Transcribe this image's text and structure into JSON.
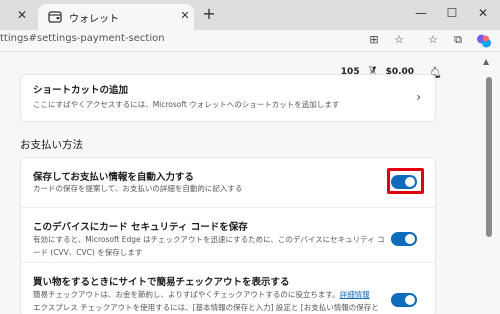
{
  "browser": {
    "tab_title": "ウォレット",
    "new_tab_glyph": "+",
    "prev_tab_close": "✕",
    "tab_close": "✕",
    "window_controls": {
      "minimize": "—",
      "maximize": "☐",
      "close": "✕"
    },
    "url": "ttings#settings-payment-section"
  },
  "wallet_bar": {
    "rewards_count": "105",
    "balance": "$0.00"
  },
  "shortcut_card": {
    "title": "ショートカットの追加",
    "description": "ここにすばやくアクセスするには、Microsoft ウォレットへのショートカットを追加します"
  },
  "payment_section": {
    "heading": "お支払い方法",
    "settings": [
      {
        "title": "保存してお支払い情報を自動入力する",
        "description": "カードの保存を提案して、お支払いの詳細を自動的に記入する",
        "enabled": true
      },
      {
        "title": "このデバイスにカード セキュリティ コードを保存",
        "description_line1": "有効にすると、Microsoft Edge はチェックアウトを迅速にするために、このデバイスにセキュリティ コ",
        "description_line2": "ード (CVV、CVC) を保存します",
        "enabled": true
      },
      {
        "title": "買い物をするときにサイトで簡易チェックアウトを表示する",
        "description_line1": "簡易チェックアウトは、お金を節約し、よりすばやくチェックアウトするのに役立ちます。",
        "link": "詳細情報",
        "description_line2": "エクスプレス チェックアウトを使用するには、[基本情報の保存と入力] 設定と [お支払い情報の保存と",
        "enabled": true
      }
    ]
  },
  "colors": {
    "toggle_on": "#0f6cbd",
    "highlight": "#e0000f"
  }
}
